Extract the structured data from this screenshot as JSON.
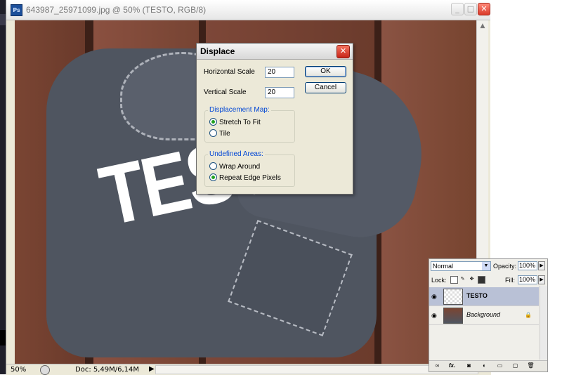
{
  "document": {
    "title": "643987_25971099.jpg @ 50% (TESTO, RGB/8)",
    "app_icon": "Ps",
    "artwork_text": "TESTO",
    "window_controls": {
      "minimize": "_",
      "maximize": "□",
      "close": "✕"
    }
  },
  "statusbar": {
    "zoom": "50%",
    "doc_info": "Doc: 5,49M/6,14M",
    "arrow": "▶"
  },
  "dialog": {
    "title": "Displace",
    "close": "✕",
    "horizontal_scale_label": "Horizontal Scale",
    "horizontal_scale_value": "20",
    "vertical_scale_label": "Vertical Scale",
    "vertical_scale_value": "20",
    "ok_label": "OK",
    "cancel_label": "Cancel",
    "displacement_map": {
      "legend": "Displacement Map:",
      "options": [
        {
          "label": "Stretch To Fit",
          "selected": true
        },
        {
          "label": "Tile",
          "selected": false
        }
      ]
    },
    "undefined_areas": {
      "legend": "Undefined Areas:",
      "options": [
        {
          "label": "Wrap Around",
          "selected": false
        },
        {
          "label": "Repeat Edge Pixels",
          "selected": true
        }
      ]
    }
  },
  "layers_panel": {
    "blend_mode": "Normal",
    "opacity_label": "Opacity:",
    "opacity_value": "100%",
    "lock_label": "Lock:",
    "fill_label": "Fill:",
    "fill_value": "100%",
    "layers": [
      {
        "name": "TESTO",
        "selected": true
      },
      {
        "name": "Background",
        "selected": false
      }
    ],
    "footer_icons": [
      "link-icon",
      "fx-icon",
      "mask-icon",
      "adjustment-icon",
      "group-icon",
      "new-layer-icon",
      "trash-icon"
    ],
    "fx_label": "fx."
  },
  "colors": {
    "accent_blue": "#0046d5",
    "selected_layer": "#b9c1d6",
    "close_red": "#d9392a",
    "wood": "#6d3c2c",
    "shirt": "#4f5560"
  }
}
